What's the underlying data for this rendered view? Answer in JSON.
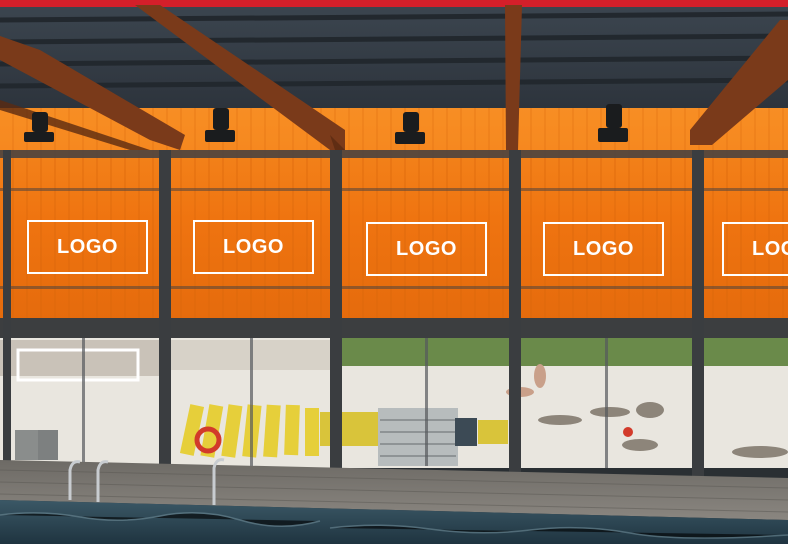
{
  "scene": {
    "description_icon": "indoor-pool-hall-photo",
    "colors": {
      "banner_orange": "#f07a12",
      "top_stripe_red": "#d41f2a",
      "steel_frame": "#3a3d40",
      "wood_beam": "#7a3a1a",
      "pool_water": "#2f4a5a"
    }
  },
  "banners": [
    {
      "label": "LOGO"
    },
    {
      "label": "LOGO"
    },
    {
      "label": "LOGO"
    },
    {
      "label": "LOGO"
    },
    {
      "label": "LOGO"
    }
  ]
}
